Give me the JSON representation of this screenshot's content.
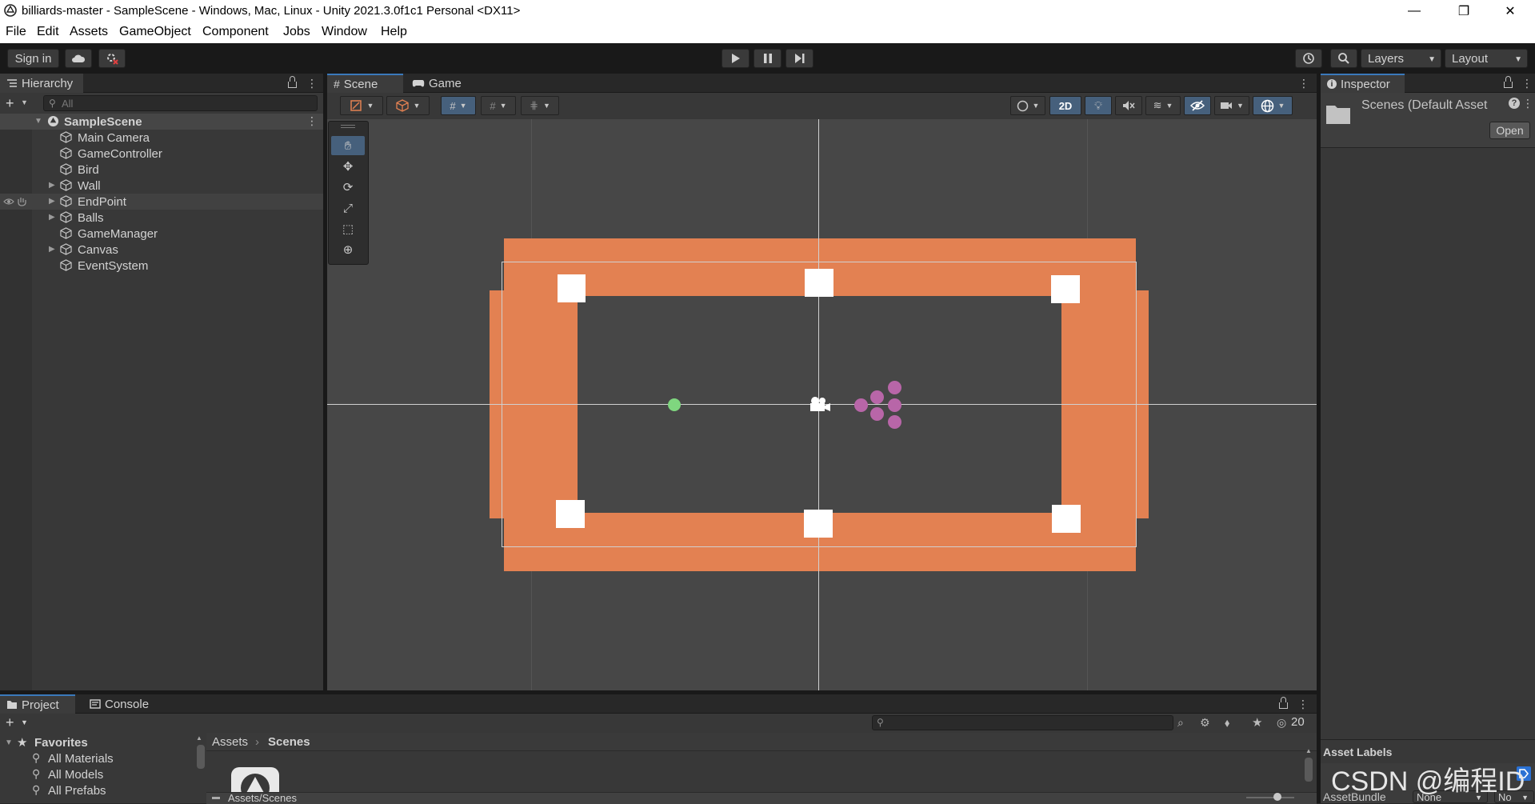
{
  "window": {
    "title": "billiards-master - SampleScene - Windows, Mac, Linux - Unity 2021.3.0f1c1 Personal <DX11>",
    "minimize": "—",
    "maximize": "❐",
    "close": "✕"
  },
  "menu": [
    "File",
    "Edit",
    "Assets",
    "GameObject",
    "Component",
    "Jobs",
    "Window",
    "Help"
  ],
  "toolbar": {
    "sign_in": "Sign in",
    "layers": "Layers",
    "layout": "Layout"
  },
  "hierarchy": {
    "tab": "Hierarchy",
    "search_placeholder": "All",
    "scene": "SampleScene",
    "items": [
      {
        "label": "Main Camera",
        "expandable": false
      },
      {
        "label": "GameController",
        "expandable": false
      },
      {
        "label": "Bird",
        "expandable": false
      },
      {
        "label": "Wall",
        "expandable": true
      },
      {
        "label": "EndPoint",
        "expandable": true
      },
      {
        "label": "Balls",
        "expandable": true
      },
      {
        "label": "GameManager",
        "expandable": false
      },
      {
        "label": "Canvas",
        "expandable": true
      },
      {
        "label": "EventSystem",
        "expandable": false
      }
    ]
  },
  "scene_tabs": {
    "scene": "Scene",
    "game": "Game",
    "toggle_2d": "2D"
  },
  "inspector": {
    "tab": "Inspector",
    "asset_title": "Scenes (Default Asset",
    "open_button": "Open",
    "asset_labels": "Asset Labels",
    "asset_bundle_label": "AssetBundle",
    "asset_bundle_value": "None",
    "asset_bundle_variant": "No"
  },
  "project": {
    "tab": "Project",
    "console_tab": "Console",
    "favorites": "Favorites",
    "favorites_items": [
      "All Materials",
      "All Models",
      "All Prefabs"
    ],
    "breadcrumb_root": "Assets",
    "breadcrumb_current": "Scenes",
    "hidden_count": "20",
    "path_footer": "Assets/Scenes"
  },
  "watermark": "CSDN @编程ID",
  "colors": {
    "wall": "#e38152",
    "bird": "#7fd67f",
    "balls": "#b866a8",
    "accent": "#3a79bb"
  }
}
